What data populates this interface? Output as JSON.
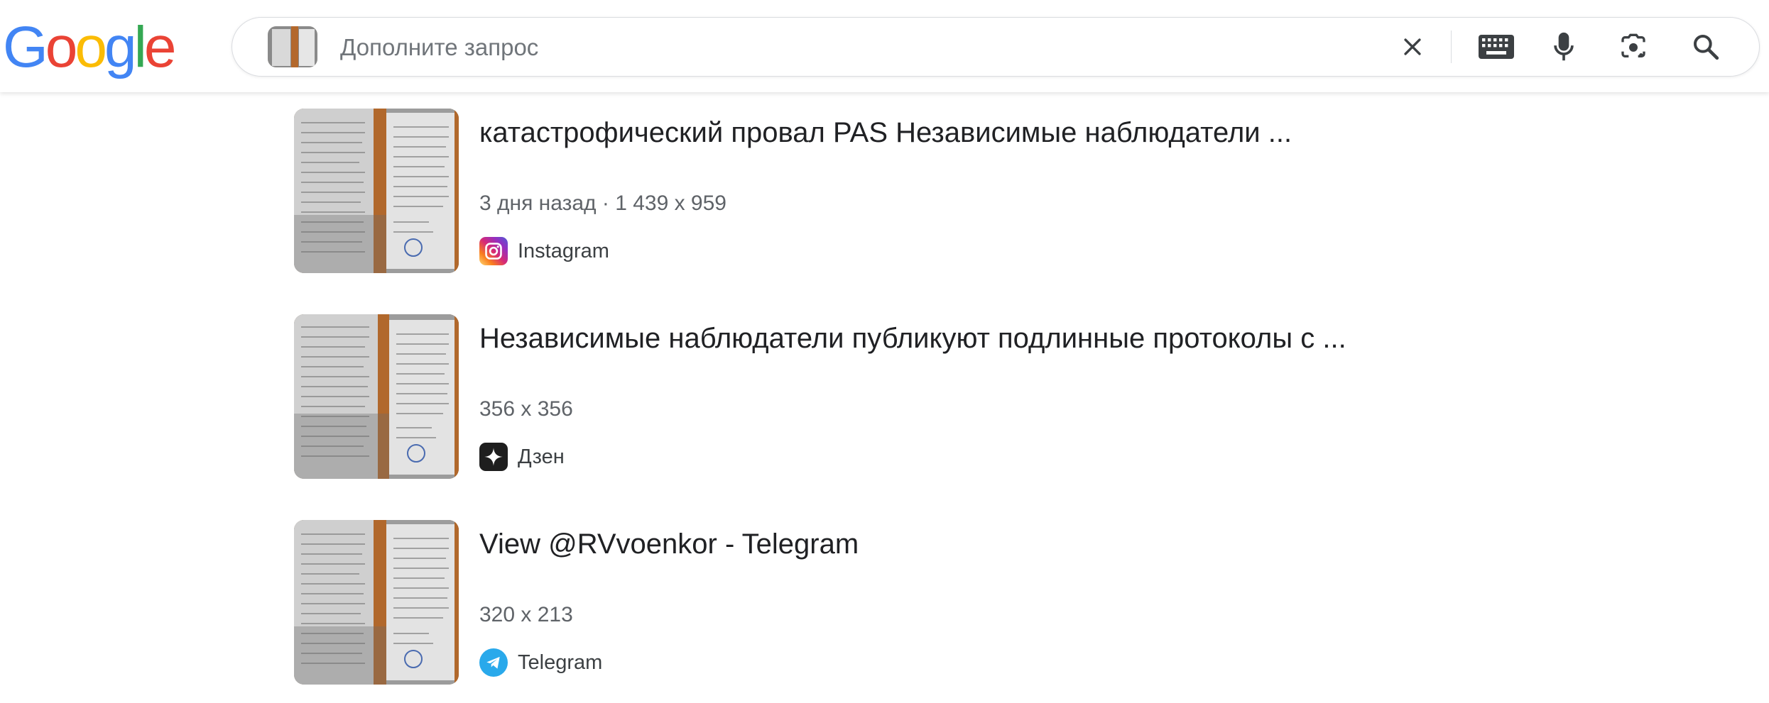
{
  "header": {
    "logo": [
      "G",
      "o",
      "o",
      "g",
      "l",
      "e"
    ],
    "logo_colors": [
      "#4285F4",
      "#EA4335",
      "#FBBC05",
      "#4285F4",
      "#34A853",
      "#EA4335"
    ],
    "search": {
      "placeholder": "Дополните запрос",
      "value": ""
    }
  },
  "icons": {
    "clear": "close-icon",
    "keyboard": "keyboard-icon",
    "voice": "microphone-icon",
    "lens": "camera-lens-icon",
    "search": "search-icon"
  },
  "results": [
    {
      "title": "катастрофический провал PAS Независимые наблюдатели ...",
      "meta": "3 дня назад · 1 439 x 959",
      "source": "Instagram",
      "source_icon": "instagram-icon"
    },
    {
      "title": "Независимые наблюдатели публикуют подлинные протоколы с ...",
      "meta": "356 x 356",
      "source": "Дзен",
      "source_icon": "dzen-icon"
    },
    {
      "title": "View @RVvoenkor - Telegram",
      "meta": "320 x 213",
      "source": "Telegram",
      "source_icon": "telegram-icon"
    }
  ]
}
